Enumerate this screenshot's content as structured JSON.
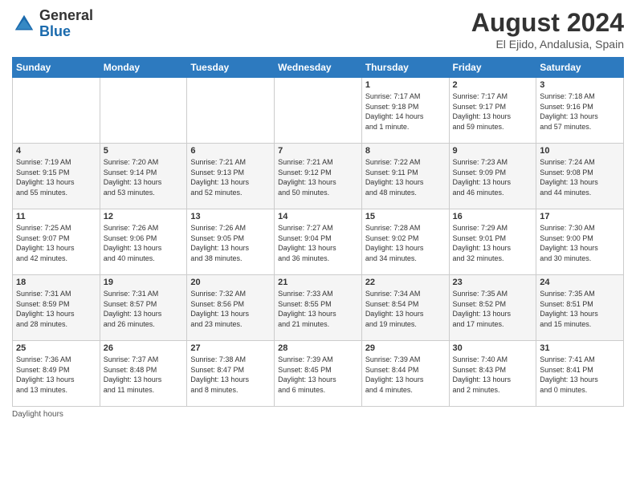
{
  "header": {
    "logo_general": "General",
    "logo_blue": "Blue",
    "month_title": "August 2024",
    "location": "El Ejido, Andalusia, Spain"
  },
  "columns": [
    "Sunday",
    "Monday",
    "Tuesday",
    "Wednesday",
    "Thursday",
    "Friday",
    "Saturday"
  ],
  "weeks": [
    {
      "days": [
        {
          "num": "",
          "info": ""
        },
        {
          "num": "",
          "info": ""
        },
        {
          "num": "",
          "info": ""
        },
        {
          "num": "",
          "info": ""
        },
        {
          "num": "1",
          "info": "Sunrise: 7:17 AM\nSunset: 9:18 PM\nDaylight: 14 hours\nand 1 minute."
        },
        {
          "num": "2",
          "info": "Sunrise: 7:17 AM\nSunset: 9:17 PM\nDaylight: 13 hours\nand 59 minutes."
        },
        {
          "num": "3",
          "info": "Sunrise: 7:18 AM\nSunset: 9:16 PM\nDaylight: 13 hours\nand 57 minutes."
        }
      ]
    },
    {
      "days": [
        {
          "num": "4",
          "info": "Sunrise: 7:19 AM\nSunset: 9:15 PM\nDaylight: 13 hours\nand 55 minutes."
        },
        {
          "num": "5",
          "info": "Sunrise: 7:20 AM\nSunset: 9:14 PM\nDaylight: 13 hours\nand 53 minutes."
        },
        {
          "num": "6",
          "info": "Sunrise: 7:21 AM\nSunset: 9:13 PM\nDaylight: 13 hours\nand 52 minutes."
        },
        {
          "num": "7",
          "info": "Sunrise: 7:21 AM\nSunset: 9:12 PM\nDaylight: 13 hours\nand 50 minutes."
        },
        {
          "num": "8",
          "info": "Sunrise: 7:22 AM\nSunset: 9:11 PM\nDaylight: 13 hours\nand 48 minutes."
        },
        {
          "num": "9",
          "info": "Sunrise: 7:23 AM\nSunset: 9:09 PM\nDaylight: 13 hours\nand 46 minutes."
        },
        {
          "num": "10",
          "info": "Sunrise: 7:24 AM\nSunset: 9:08 PM\nDaylight: 13 hours\nand 44 minutes."
        }
      ]
    },
    {
      "days": [
        {
          "num": "11",
          "info": "Sunrise: 7:25 AM\nSunset: 9:07 PM\nDaylight: 13 hours\nand 42 minutes."
        },
        {
          "num": "12",
          "info": "Sunrise: 7:26 AM\nSunset: 9:06 PM\nDaylight: 13 hours\nand 40 minutes."
        },
        {
          "num": "13",
          "info": "Sunrise: 7:26 AM\nSunset: 9:05 PM\nDaylight: 13 hours\nand 38 minutes."
        },
        {
          "num": "14",
          "info": "Sunrise: 7:27 AM\nSunset: 9:04 PM\nDaylight: 13 hours\nand 36 minutes."
        },
        {
          "num": "15",
          "info": "Sunrise: 7:28 AM\nSunset: 9:02 PM\nDaylight: 13 hours\nand 34 minutes."
        },
        {
          "num": "16",
          "info": "Sunrise: 7:29 AM\nSunset: 9:01 PM\nDaylight: 13 hours\nand 32 minutes."
        },
        {
          "num": "17",
          "info": "Sunrise: 7:30 AM\nSunset: 9:00 PM\nDaylight: 13 hours\nand 30 minutes."
        }
      ]
    },
    {
      "days": [
        {
          "num": "18",
          "info": "Sunrise: 7:31 AM\nSunset: 8:59 PM\nDaylight: 13 hours\nand 28 minutes."
        },
        {
          "num": "19",
          "info": "Sunrise: 7:31 AM\nSunset: 8:57 PM\nDaylight: 13 hours\nand 26 minutes."
        },
        {
          "num": "20",
          "info": "Sunrise: 7:32 AM\nSunset: 8:56 PM\nDaylight: 13 hours\nand 23 minutes."
        },
        {
          "num": "21",
          "info": "Sunrise: 7:33 AM\nSunset: 8:55 PM\nDaylight: 13 hours\nand 21 minutes."
        },
        {
          "num": "22",
          "info": "Sunrise: 7:34 AM\nSunset: 8:54 PM\nDaylight: 13 hours\nand 19 minutes."
        },
        {
          "num": "23",
          "info": "Sunrise: 7:35 AM\nSunset: 8:52 PM\nDaylight: 13 hours\nand 17 minutes."
        },
        {
          "num": "24",
          "info": "Sunrise: 7:35 AM\nSunset: 8:51 PM\nDaylight: 13 hours\nand 15 minutes."
        }
      ]
    },
    {
      "days": [
        {
          "num": "25",
          "info": "Sunrise: 7:36 AM\nSunset: 8:49 PM\nDaylight: 13 hours\nand 13 minutes."
        },
        {
          "num": "26",
          "info": "Sunrise: 7:37 AM\nSunset: 8:48 PM\nDaylight: 13 hours\nand 11 minutes."
        },
        {
          "num": "27",
          "info": "Sunrise: 7:38 AM\nSunset: 8:47 PM\nDaylight: 13 hours\nand 8 minutes."
        },
        {
          "num": "28",
          "info": "Sunrise: 7:39 AM\nSunset: 8:45 PM\nDaylight: 13 hours\nand 6 minutes."
        },
        {
          "num": "29",
          "info": "Sunrise: 7:39 AM\nSunset: 8:44 PM\nDaylight: 13 hours\nand 4 minutes."
        },
        {
          "num": "30",
          "info": "Sunrise: 7:40 AM\nSunset: 8:43 PM\nDaylight: 13 hours\nand 2 minutes."
        },
        {
          "num": "31",
          "info": "Sunrise: 7:41 AM\nSunset: 8:41 PM\nDaylight: 13 hours\nand 0 minutes."
        }
      ]
    }
  ],
  "footer_note": "Daylight hours"
}
